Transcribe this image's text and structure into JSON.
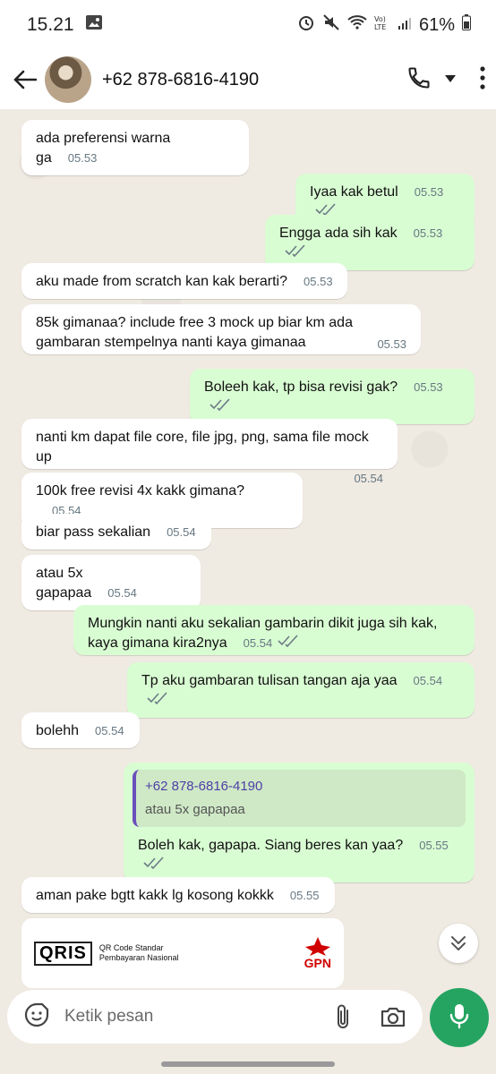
{
  "status_bar": {
    "time": "15.21",
    "battery": "61%"
  },
  "header": {
    "contact_name": "+62 878-6816-4190"
  },
  "messages": [
    {
      "dir": "in",
      "text": "ada preferensi warna ga",
      "time": "05.53"
    },
    {
      "dir": "out",
      "text": "Iyaa kak betul",
      "time": "05.53"
    },
    {
      "dir": "out",
      "text": "Engga ada sih kak",
      "time": "05.53"
    },
    {
      "dir": "in",
      "text": "aku made from scratch kan kak berarti?",
      "time": "05.53"
    },
    {
      "dir": "in",
      "text": "85k gimanaa? include free 3 mock up biar km ada gambaran stempelnya nanti kaya gimanaa",
      "time": "05.53"
    },
    {
      "dir": "out",
      "text": "Boleeh kak, tp bisa revisi gak?",
      "time": "05.53"
    },
    {
      "dir": "in",
      "text": "nanti km dapat file core, file jpg, png, sama file mock up",
      "time": "05.54"
    },
    {
      "dir": "in",
      "text": "100k free revisi 4x kakk gimana?",
      "time": "05.54"
    },
    {
      "dir": "in",
      "text": "biar pass sekalian",
      "time": "05.54"
    },
    {
      "dir": "in",
      "text": "atau 5x gapapaa",
      "time": "05.54"
    },
    {
      "dir": "out",
      "text": "Mungkin nanti aku sekalian gambarin dikit juga sih kak, kaya gimana kira2nya",
      "time": "05.54"
    },
    {
      "dir": "out",
      "text": "Tp aku gambaran tulisan tangan aja yaa",
      "time": "05.54"
    },
    {
      "dir": "in",
      "text": "bolehh",
      "time": "05.54"
    },
    {
      "dir": "out",
      "text": "Boleh kak, gapapa. Siang beres kan yaa?",
      "time": "05.55",
      "reply_to": {
        "name": "+62 878-6816-4190",
        "text": "atau 5x gapapaa"
      }
    },
    {
      "dir": "in",
      "text": "aman pake bgtt kakk lg kosong kokkk",
      "time": "05.55"
    }
  ],
  "qris_card": {
    "logo": "QRIS",
    "subtitle_line1": "QR Code Standar",
    "subtitle_line2": "Pembayaran Nasional",
    "gpn": "GPN"
  },
  "composer": {
    "placeholder": "Ketik pesan"
  },
  "icons": {
    "back": "arrow-left-icon",
    "call": "phone-icon",
    "dropdown": "caret-down-icon",
    "more": "kebab-menu-icon",
    "emoji": "emoji-icon",
    "attach": "paperclip-icon",
    "camera": "camera-icon",
    "mic": "microphone-icon",
    "scroll_down": "double-chevron-down-icon"
  },
  "colors": {
    "incoming_bubble": "#ffffff",
    "outgoing_bubble": "#d9fdd3",
    "chat_background": "#efeae2",
    "mic_button": "#25a461",
    "reply_accent": "#6b4fbb"
  }
}
